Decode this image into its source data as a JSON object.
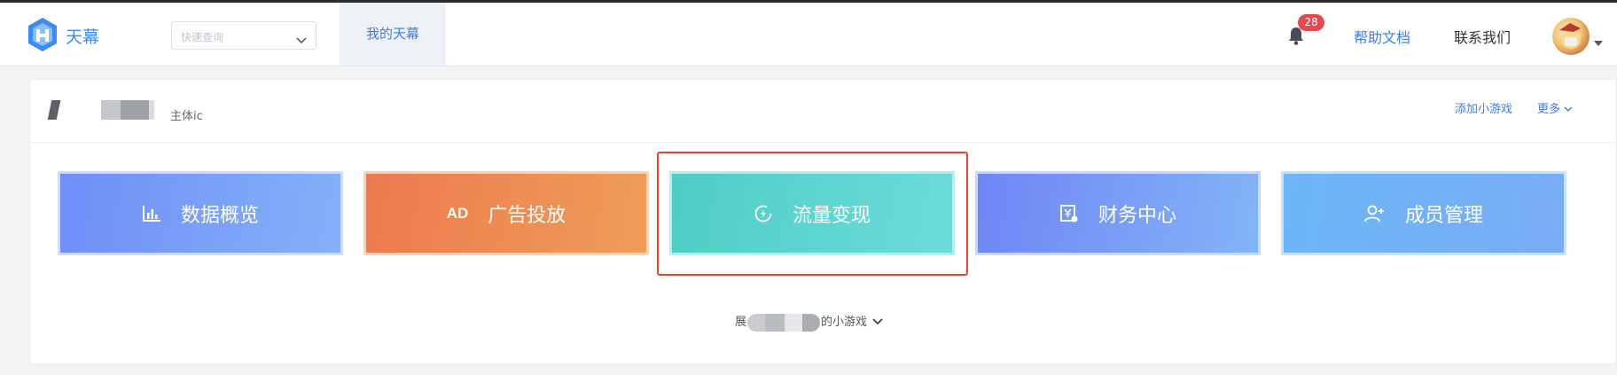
{
  "header": {
    "logo_text": "天幕",
    "quick_query": {
      "placeholder": "快速查询"
    },
    "nav_tab": "我的天幕",
    "notification_count": "28",
    "help_link": "帮助文档",
    "contact_link": "联系我们"
  },
  "app_card": {
    "entity_label": "主体ic",
    "add_game_link": "添加小游戏",
    "more_link": "更多",
    "tiles": [
      {
        "label": "数据概览",
        "icon": "bar-chart-icon"
      },
      {
        "label": "广告投放",
        "icon": "ad-icon",
        "icon_text": "AD"
      },
      {
        "label": "流量变现",
        "icon": "monetize-icon"
      },
      {
        "label": "财务中心",
        "icon": "finance-icon"
      },
      {
        "label": "成员管理",
        "icon": "add-member-icon"
      }
    ],
    "expand_prefix": "展",
    "expand_suffix": "的小游戏"
  },
  "colors": {
    "accent_blue": "#3d7de6",
    "badge_red": "#e5484d",
    "highlight_red": "#e2482d"
  }
}
